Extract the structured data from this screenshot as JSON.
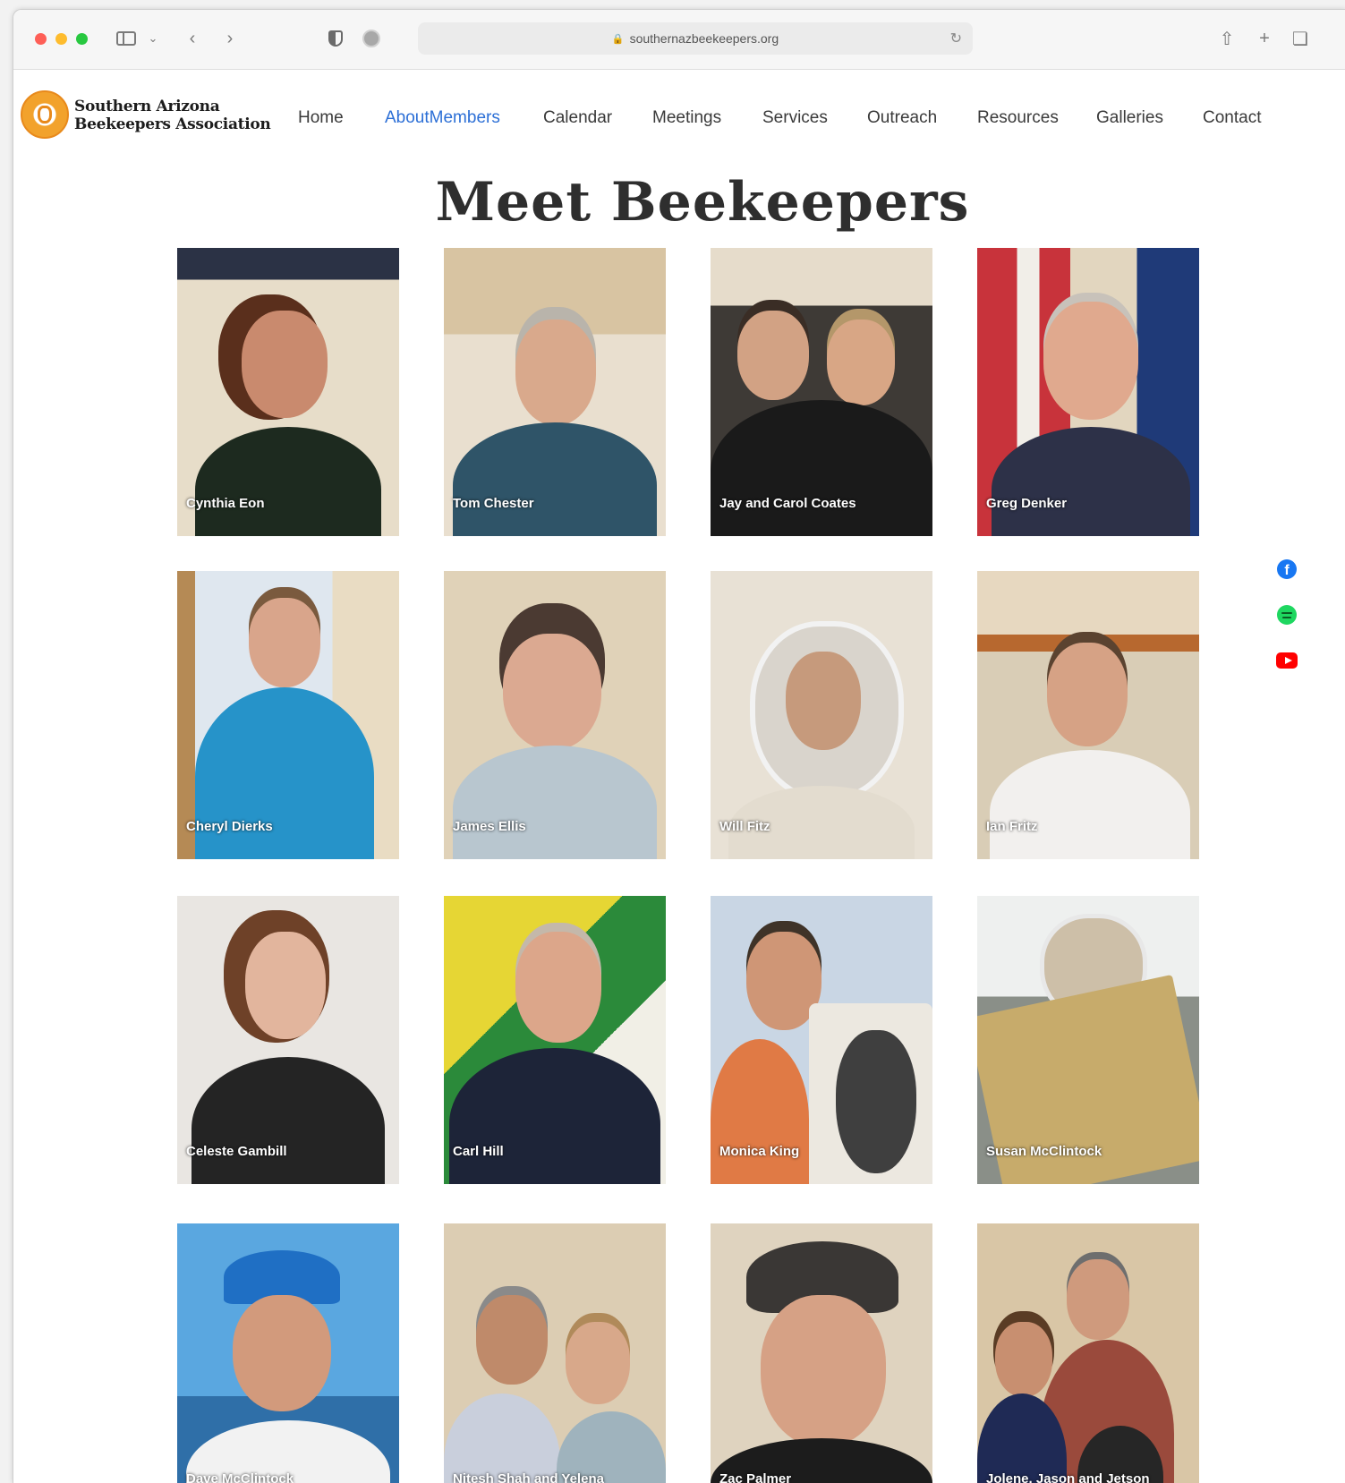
{
  "browser": {
    "url": "southernazbeekeepers.org"
  },
  "site": {
    "org_name_line1": "Southern Arizona",
    "org_name_line2": "Beekeepers Association"
  },
  "nav": {
    "items": [
      {
        "label": "Home",
        "active": false
      },
      {
        "label": "AboutMembers",
        "active": true
      },
      {
        "label": "Calendar",
        "active": false
      },
      {
        "label": "Meetings",
        "active": false
      },
      {
        "label": "Services",
        "active": false
      },
      {
        "label": "Outreach",
        "active": false
      },
      {
        "label": "Resources",
        "active": false
      },
      {
        "label": "Galleries",
        "active": false
      },
      {
        "label": "Contact",
        "active": false
      }
    ]
  },
  "main": {
    "title": "Meet Beekeepers",
    "members": [
      {
        "name": "Cynthia Eon"
      },
      {
        "name": "Tom Chester"
      },
      {
        "name": "Jay and Carol Coates"
      },
      {
        "name": "Greg Denker"
      },
      {
        "name": "Cheryl Dierks"
      },
      {
        "name": "James Ellis"
      },
      {
        "name": "Will Fitz"
      },
      {
        "name": "Ian Fritz"
      },
      {
        "name": "Celeste Gambill"
      },
      {
        "name": "Carl Hill"
      },
      {
        "name": "Monica King"
      },
      {
        "name": "Susan McClintock"
      },
      {
        "name": "Dave McClintock"
      },
      {
        "name": "Nitesh Shah and Yelena"
      },
      {
        "name": "Zac Palmer"
      },
      {
        "name": "Jolene, Jason and Jetson"
      }
    ]
  },
  "social": {
    "icons": [
      "facebook-icon",
      "spotify-icon",
      "youtube-icon"
    ]
  },
  "colors": {
    "nav_active": "#2c6fd6",
    "logo_orange": "#f2a22c"
  }
}
